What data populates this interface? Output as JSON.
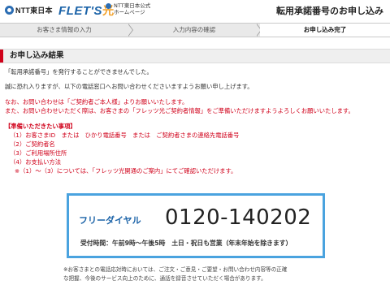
{
  "header": {
    "ntt_logo": "NTT東日本",
    "flets_logo": "FLET'S",
    "flets_mark": "光",
    "official_line1": "NTT東日本公式",
    "official_line2": "ホームページ",
    "page_title": "転用承諾番号のお申し込み"
  },
  "steps": [
    {
      "label": "お客さま情報の入力"
    },
    {
      "label": "入力内容の確認"
    },
    {
      "label": "お申し込み完了"
    }
  ],
  "section": {
    "title": "お申し込み結果"
  },
  "messages": {
    "line1": "「転用承諾番号」を発行することができませんでした。",
    "line2": "誠に恐れ入りますが、以下の電話窓口へお問い合わせくださいますようお願い申し上げます。",
    "line3": "なお、お問い合わせは「ご契約者ご本人様」よりお願いいたします。",
    "line4": "また、お問い合わせいただく際は、お客さまの「フレッツ光ご契約者情報」をご準備いただけますようよろしくお願いいたします。"
  },
  "requirements": {
    "title": "【準備いただきたい事項】",
    "item1": "（1）お客さまID　または　ひかり電話番号　または　ご契約者さまの連絡先電話番号",
    "item2": "（2）ご契約者名",
    "item3": "（3）ご利用場所住所",
    "item4": "（4）お支払い方法",
    "note": "※（1）～（3）については、「フレッツ光開通のご案内」にてご確認いただけます。"
  },
  "contact": {
    "label": "フリーダイヤル",
    "number": "0120-140202",
    "hours": "受付時間：午前9時～午後5時　土日・祝日も営業（年末年始を除きます）"
  },
  "footnote": {
    "line1": "※お客さまとの電話応対時においては、ご注文・ご意見・ご要望・お問い合わせ内容等の正確",
    "line2": "な把握、今後のサービス向上のために、通話を録音させていただく場合があります。"
  },
  "colors": {
    "accent_red": "#d0021b",
    "brand_blue": "#1b63a8",
    "box_border": "#4aa3df"
  }
}
